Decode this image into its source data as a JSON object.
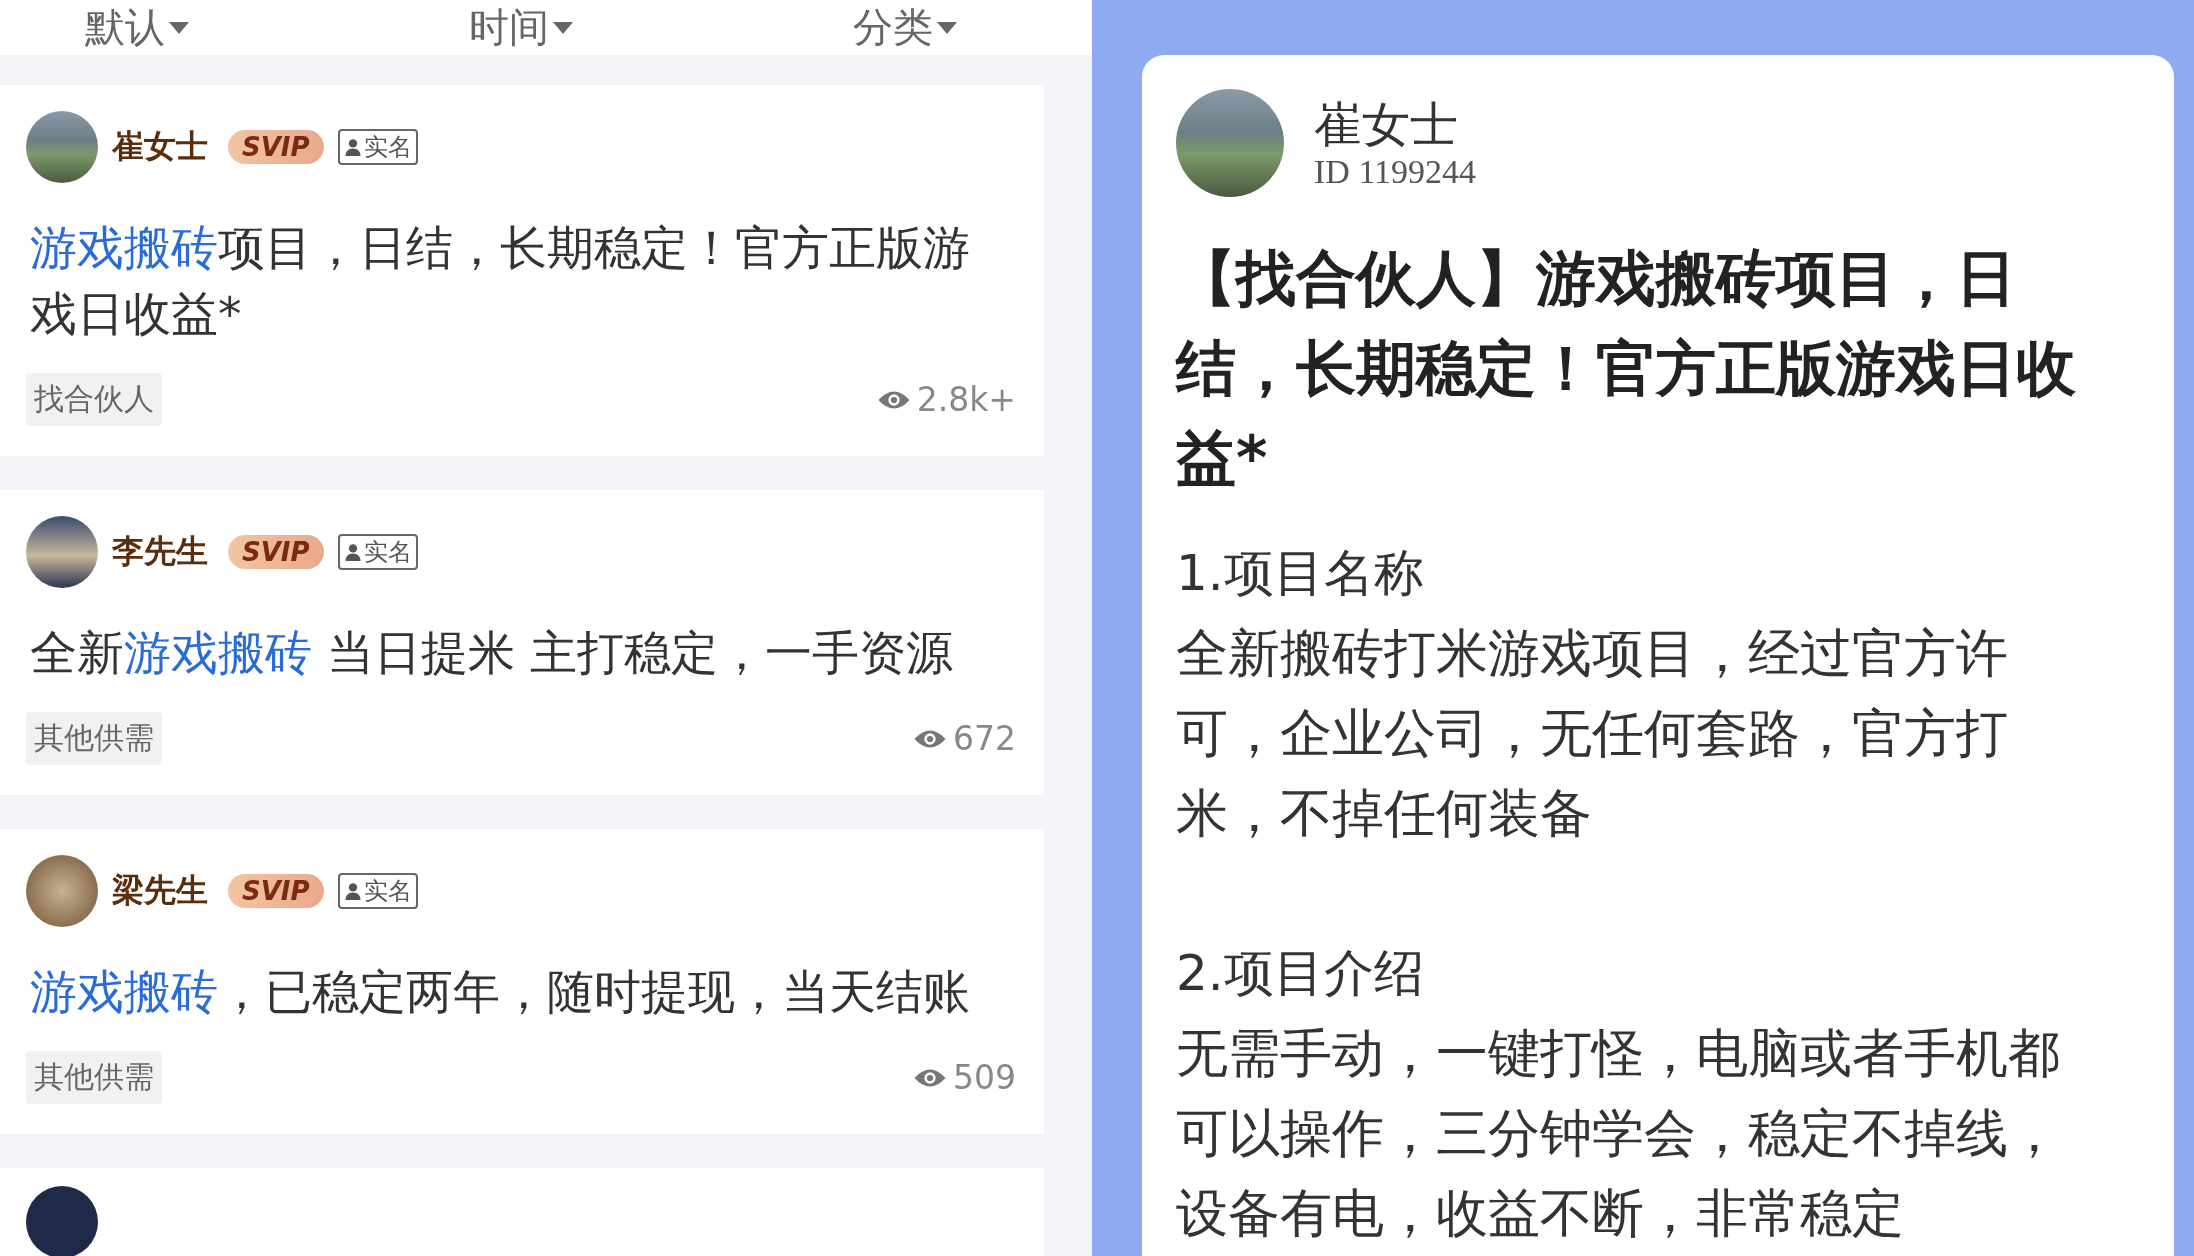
{
  "sort_bar": {
    "items": [
      {
        "label": "默认"
      },
      {
        "label": "时间"
      },
      {
        "label": "分类"
      }
    ]
  },
  "posts": [
    {
      "author": "崔女士",
      "badge": "SVIP",
      "verified": "实名",
      "title": [
        {
          "kind": "keyword",
          "text": "游戏搬砖"
        },
        {
          "kind": "plain",
          "text": "项目，日结，长期稳定！官方正版游戏日收益*"
        }
      ],
      "tag": "找合伙人",
      "views": "2.8k+"
    },
    {
      "author": "李先生",
      "badge": "SVIP",
      "verified": "实名",
      "title": [
        {
          "kind": "plain",
          "text": "全新"
        },
        {
          "kind": "keyword",
          "text": "游戏搬砖"
        },
        {
          "kind": "plain",
          "text": " 当日提米 主打稳定，一手资源"
        }
      ],
      "tag": "其他供需",
      "views": "672"
    },
    {
      "author": "梁先生",
      "badge": "SVIP",
      "verified": "实名",
      "title": [
        {
          "kind": "keyword",
          "text": "游戏搬砖"
        },
        {
          "kind": "plain",
          "text": "，已稳定两年，随时提现，当天结账"
        }
      ],
      "tag": "其他供需",
      "views": "509"
    }
  ],
  "detail": {
    "author": "崔女士",
    "id_text": "ID 1199244",
    "title": "【找合伙人】游戏搬砖项目，日结，长期稳定！官方正版游戏日收益*",
    "sections": [
      {
        "heading": "1.项目名称",
        "body": "全新搬砖打米游戏项目，经过官方许可，企业公司，无任何套路，官方打米，不掉任何装备"
      },
      {
        "heading": "2.项目介绍",
        "body": "无需手动，一键打怪，电脑或者手机都可以操作，三分钟学会，稳定不掉线，设备有电，收益不断，非常稳定"
      }
    ]
  }
}
